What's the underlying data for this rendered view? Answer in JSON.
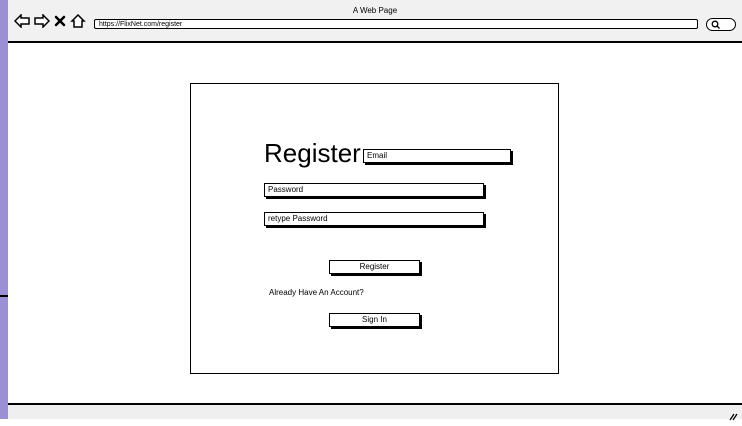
{
  "window": {
    "title": "A Web Page"
  },
  "browser": {
    "url": "https://FlixNet.com/register",
    "icons": [
      "back-arrow-icon",
      "forward-arrow-icon",
      "close-x-icon",
      "home-icon",
      "search-icon"
    ]
  },
  "form": {
    "heading": "Register",
    "email_value": "Email",
    "password_value": "Password",
    "retype_password_value": "retype Password",
    "register_button": "Register",
    "already_text": "Already Have An Account?",
    "signin_button": "Sign In"
  }
}
